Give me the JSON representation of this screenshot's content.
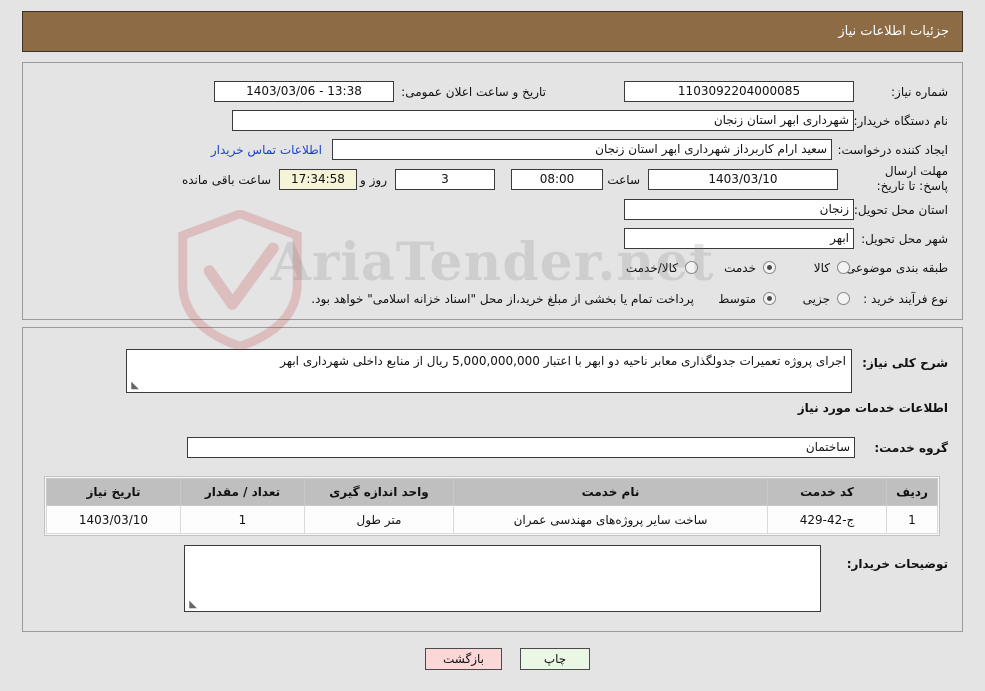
{
  "header": {
    "title": "جزئیات اطلاعات نیاز"
  },
  "form": {
    "need_number_label": "شماره نیاز:",
    "need_number_value": "1103092204000085",
    "buyer_org_label": "نام دستگاه خریدار:",
    "buyer_org_value": "شهرداری ابهر استان زنجان",
    "creator_label": "ایجاد کننده درخواست:",
    "creator_value": "سعید ارام کاربرداز  شهرداری ابهر استان زنجان",
    "deadline_label": "مهلت ارسال پاسخ: تا تاریخ:",
    "deadline_date": "1403/03/10",
    "hour_label": "ساعت",
    "hour_value": "08:00",
    "days_value": "3",
    "days_label": "روز و",
    "remaining_value": "17:34:58",
    "remaining_label": "ساعت باقی مانده",
    "province_label": "استان محل تحویل:",
    "province_value": "زنجان",
    "city_label": "شهر محل تحویل:",
    "city_value": "ابهر",
    "announce_label": "تاریخ و ساعت اعلان عمومی:",
    "announce_value": "13:38 - 1403/03/06",
    "contact_link": "اطلاعات تماس خریدار",
    "category_label": "طبقه بندی موضوعی:",
    "category_options": [
      {
        "label": "کالا",
        "selected": false
      },
      {
        "label": "خدمت",
        "selected": true
      },
      {
        "label": "کالا/خدمت",
        "selected": false
      }
    ],
    "process_label": "نوع فرآیند خرید :",
    "process_options": [
      {
        "label": "جزیی",
        "selected": false
      },
      {
        "label": "متوسط",
        "selected": true
      }
    ],
    "process_note": "پرداخت تمام یا بخشی از مبلغ خرید،از محل \"اسناد خزانه اسلامی\" خواهد بود."
  },
  "description": {
    "label": "شرح کلی نیاز:",
    "value": "اجرای پروژه تعمیرات جدولگذاری معابر ناحیه دو ابهر با اعتبار 5,000,000,000 ریال از منابع داخلی شهرداری ابهر"
  },
  "services": {
    "section_title": "اطلاعات خدمات مورد نیاز",
    "group_label": "گروه خدمت:",
    "group_value": "ساختمان",
    "table": {
      "columns": [
        "ردیف",
        "کد خدمت",
        "نام خدمت",
        "واحد اندازه گیری",
        "تعداد / مقدار",
        "تاریخ نیاز"
      ],
      "rows": [
        {
          "row": "1",
          "code": "ج-42-429",
          "name": "ساخت سایر پروژه‌های مهندسی عمران",
          "unit": "متر طول",
          "qty": "1",
          "date": "1403/03/10"
        }
      ]
    }
  },
  "notes": {
    "label": "توضیحات خریدار:",
    "value": ""
  },
  "footer": {
    "print_label": "چاپ",
    "back_label": "بازگشت"
  },
  "watermark": {
    "text": "AriaTender.net"
  }
}
